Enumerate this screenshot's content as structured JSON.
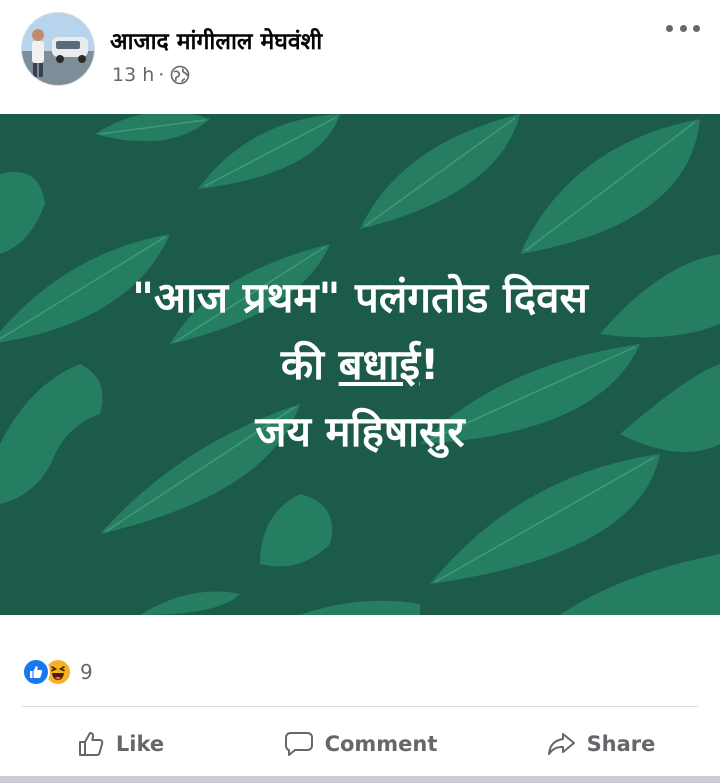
{
  "post": {
    "author": "आजाद मांगीलाल मेघवंशी",
    "time": "13 h",
    "separator": "·",
    "privacy_icon": "globe-icon",
    "more_icon": "more-options-icon"
  },
  "banner": {
    "background_color": "#1c5a4a",
    "leaf_color": "#2a8a6a",
    "line1": "\"आज प्रथम\" पलंगतोड दिवस",
    "line2_prefix": "की ",
    "line2_underlined": "बधाई",
    "line2_suffix": "!",
    "line3": "जय महिषासुर"
  },
  "reactions": {
    "icons": [
      "like-reaction-icon",
      "haha-reaction-icon"
    ],
    "count": "9"
  },
  "actions": {
    "like_label": "Like",
    "comment_label": "Comment",
    "share_label": "Share"
  }
}
